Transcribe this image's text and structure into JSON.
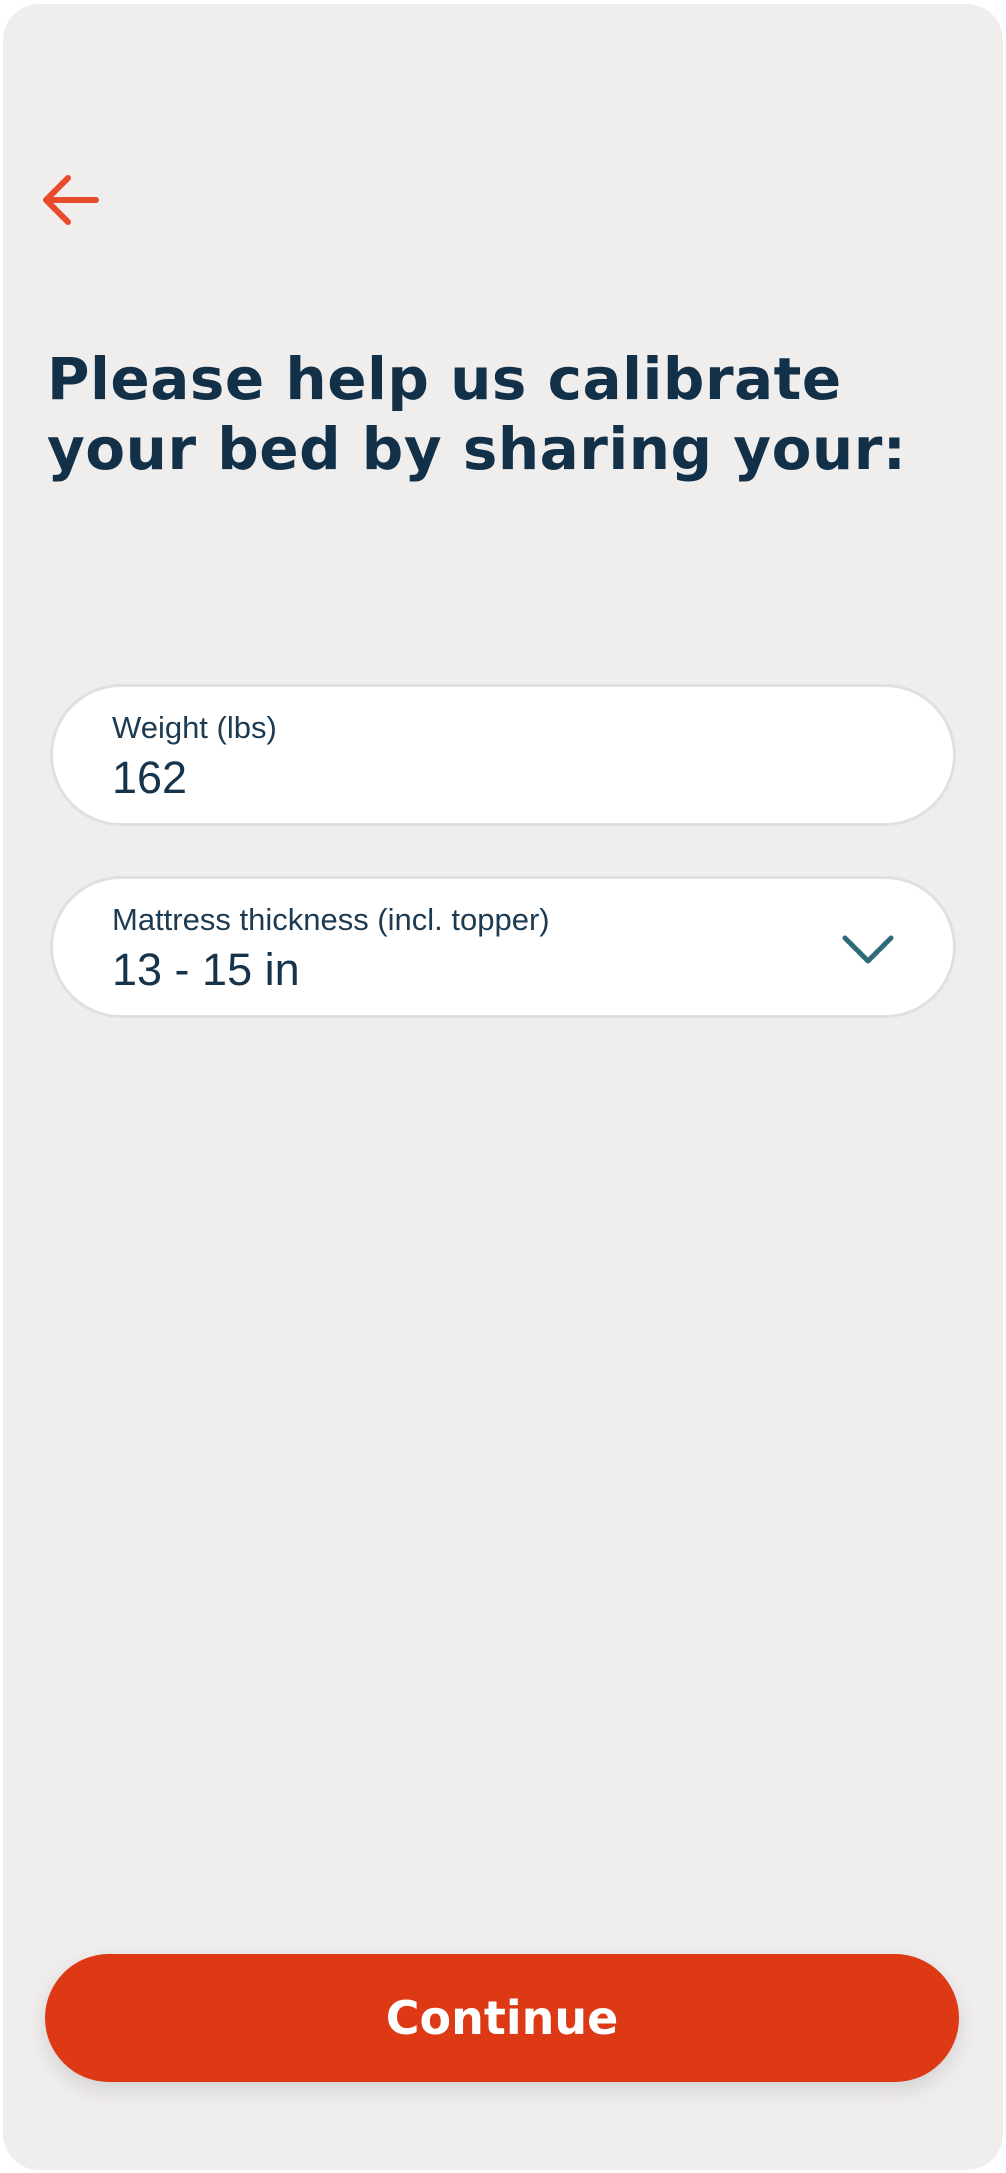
{
  "colors": {
    "background": "#f0eded",
    "accent": "#dc3914",
    "back_arrow": "#e84b2a",
    "heading": "#123149",
    "chevron": "#2f6a7a",
    "field_background": "#ffffff"
  },
  "header": {
    "back_icon": "arrow-left-icon"
  },
  "heading": "Please help us calibrate your bed by sharing your:",
  "form": {
    "weight": {
      "label": "Weight (lbs)",
      "value": "162"
    },
    "mattress": {
      "label": "Mattress thickness (incl. topper)",
      "selected": "13 - 15 in",
      "icon": "chevron-down-icon"
    }
  },
  "footer": {
    "continue_label": "Continue"
  }
}
